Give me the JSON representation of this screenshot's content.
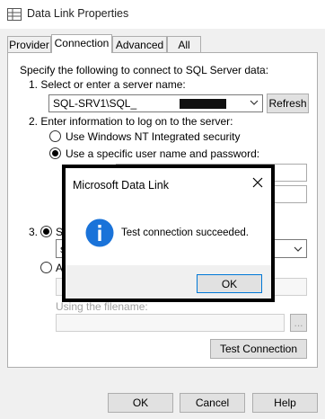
{
  "window": {
    "title": "Data Link Properties"
  },
  "tabs": [
    {
      "label": "Provider"
    },
    {
      "label": "Connection"
    },
    {
      "label": "Advanced"
    },
    {
      "label": "All"
    }
  ],
  "connection": {
    "intro": "Specify the following to connect to SQL Server data:",
    "step1_label": "1. Select or enter a server name:",
    "server_value": "SQL-SRV1\\SQL_",
    "refresh_label": "Refresh",
    "step2_label": "2. Enter information to log on to the server:",
    "opt_windows": "Use Windows NT Integrated security",
    "opt_specific": "Use a specific user name and password:",
    "step3_label": "3.",
    "step3_opt1_partial": "Se",
    "step3_opt2_partial": "At",
    "step3_value_partial": "s",
    "filename_label": "Using the filename:",
    "browse_label": "...",
    "test_label": "Test Connection"
  },
  "footer": {
    "ok_label": "OK",
    "cancel_label": "Cancel",
    "help_label": "Help"
  },
  "dialog": {
    "title": "Microsoft Data Link",
    "message": "Test connection succeeded.",
    "ok_label": "OK"
  },
  "colors": {
    "info_icon": "#1a73d9",
    "focus": "#0078d7"
  }
}
